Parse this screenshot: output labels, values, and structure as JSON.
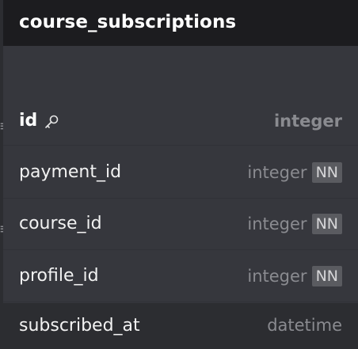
{
  "table": {
    "name": "course_subscriptions",
    "columns": [
      {
        "name": "id",
        "type": "integer",
        "primary_key": true,
        "badge": "",
        "icon": "key-icon"
      },
      {
        "name": "payment_id",
        "type": "integer",
        "primary_key": false,
        "badge": "NN"
      },
      {
        "name": "course_id",
        "type": "integer",
        "primary_key": false,
        "badge": "NN"
      },
      {
        "name": "profile_id",
        "type": "integer",
        "primary_key": false,
        "badge": "NN"
      },
      {
        "name": "subscribed_at",
        "type": "datetime",
        "primary_key": false,
        "badge": ""
      }
    ]
  },
  "connector_glyph": "≡"
}
